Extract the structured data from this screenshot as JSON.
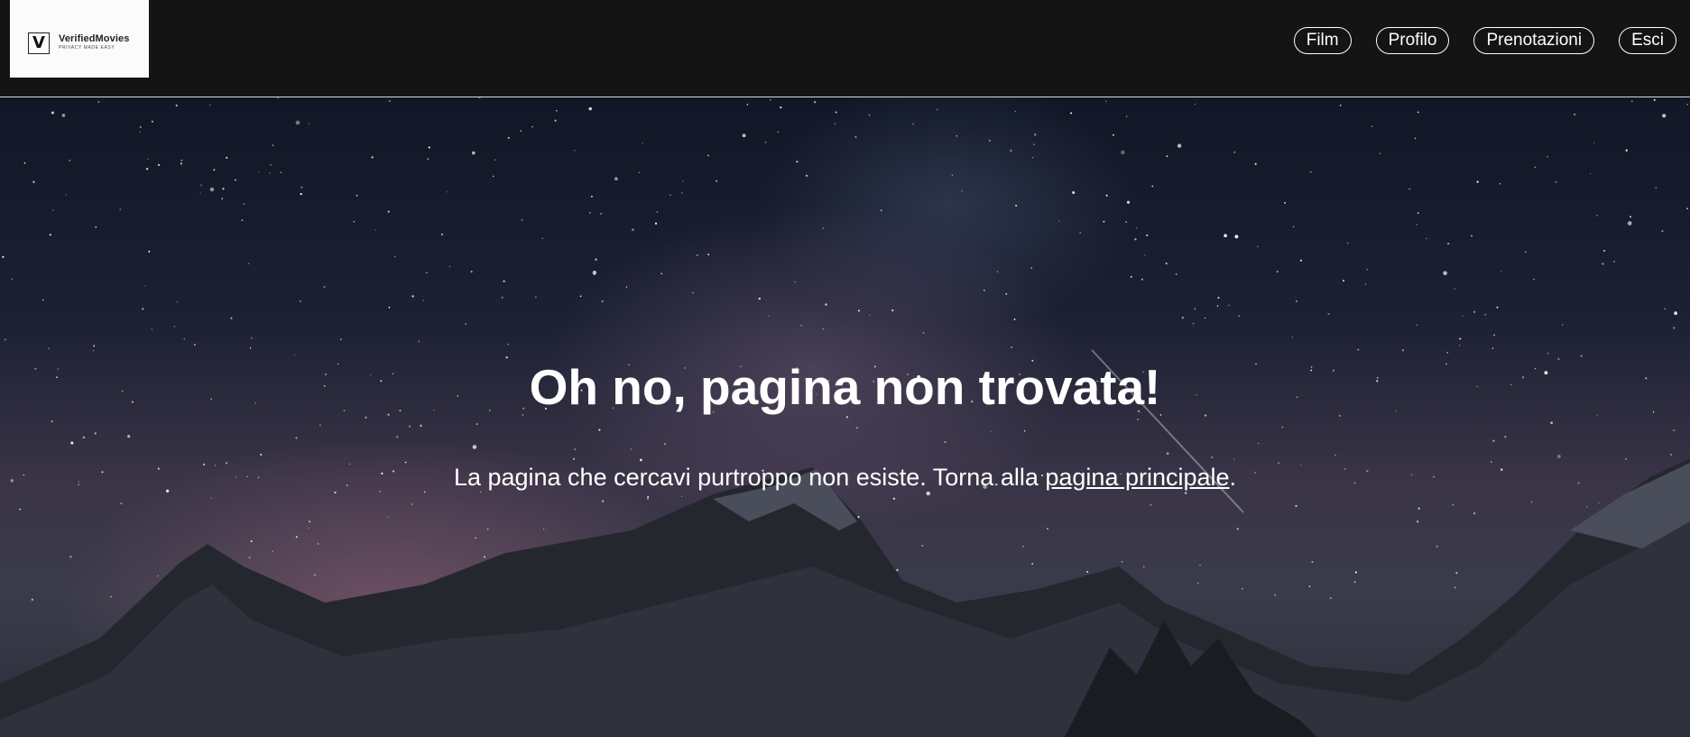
{
  "header": {
    "logo": {
      "mark": "V",
      "name": "VerifiedMovies",
      "tagline": "PRIVACY MADE EASY"
    },
    "nav": [
      {
        "label": "Film",
        "icon": ""
      },
      {
        "label": "Profilo",
        "icon": ""
      },
      {
        "label": "Prenotazioni",
        "icon": ""
      },
      {
        "label": "Esci",
        "icon": ""
      }
    ]
  },
  "main": {
    "title": "Oh no, pagina non trovata!",
    "message_before": "La pagina che cercavi purtroppo non esiste. Torna alla ",
    "link_text": "pagina principale",
    "message_after": "."
  },
  "colors": {
    "header_background": "#141414",
    "header_border": "#d9d9d9",
    "text": "#ffffff",
    "logo_background": "#fbfbfb"
  }
}
